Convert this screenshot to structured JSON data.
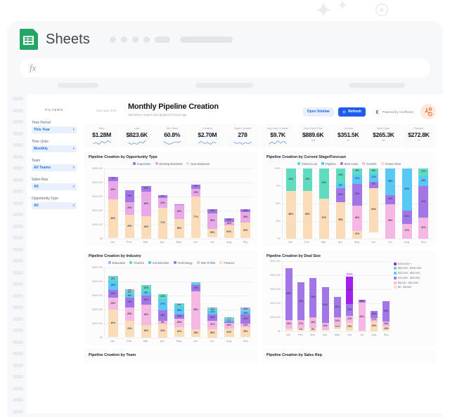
{
  "app": {
    "name": "Sheets",
    "logo_icon": "sheets-icon",
    "formula_placeholder": "fx"
  },
  "dashboard": {
    "logo_placeholder": "Your logo here",
    "title": "Monthly Pipeline Creation",
    "subtitle": "Salesforce import last updated 9 hours ago",
    "buttons": {
      "sidebar": "Open Sidebar",
      "refresh": "Refresh",
      "refresh_icon": "refresh-icon"
    },
    "powered_by": "Powered by Coefficient",
    "powered_icon": "coefficient-icon",
    "brand_icon": "hubspot-icon"
  },
  "filters": {
    "heading": "FILTERS",
    "items": [
      {
        "label": "Time Period",
        "value": "This Year"
      },
      {
        "label": "Time Units",
        "value": "Monthly"
      },
      {
        "label": "Team",
        "value": "All Teams"
      },
      {
        "label": "Sales Rep",
        "value": "All"
      },
      {
        "label": "Opportunity Type",
        "value": "All"
      }
    ]
  },
  "kpis": [
    {
      "label": "Won",
      "value": "$1.28M",
      "count": ""
    },
    {
      "label": "Lost",
      "value": "$823.6K",
      "count": ""
    },
    {
      "label": "Win Rate",
      "value": "60.8%",
      "count": ""
    },
    {
      "label": "Created",
      "value": "$2.70M",
      "count": ""
    },
    {
      "label": "Opps Created",
      "value": "278",
      "count": ""
    },
    {
      "label": "Avg Deal Created",
      "value": "$9.7K",
      "count": ""
    },
    {
      "label": "Total Open Pipe",
      "value": "$889.6K",
      "count": "140"
    },
    {
      "label": "Commit",
      "value": "$351.5K",
      "count": "40"
    },
    {
      "label": "Best Case",
      "value": "$265.3K",
      "count": "25"
    },
    {
      "label": "Pipeline",
      "value": "$272.8K",
      "count": "75"
    }
  ],
  "bottom_cards": [
    {
      "title": "Pipeline Creation by Team"
    },
    {
      "title": "Pipeline Creation by Sales Rep"
    }
  ],
  "chart_data": [
    {
      "type": "bar",
      "stacked": true,
      "title": "Pipeline Creation by Opportunity Type",
      "categories": [
        "Jan",
        "Feb",
        "Mar",
        "Apr",
        "May",
        "Jun",
        "Jul",
        "Aug",
        "Sep"
      ],
      "ylabel": "",
      "xlabel": "",
      "ylim": [
        0,
        500000
      ],
      "yticks": [
        "$0",
        "$100,000",
        "$200,000",
        "$300,000",
        "$400,000",
        "$500,000"
      ],
      "grid": true,
      "legend_position": "top",
      "totals": [
        440000,
        344000,
        375000,
        310000,
        241000,
        385000,
        209000,
        145000,
        206000
      ],
      "series": [
        {
          "name": "New Business",
          "color": "#fbdcb9",
          "values": [
            63,
            49,
            43,
            71,
            58,
            77,
            30,
            64,
            54
          ]
        },
        {
          "name": "Existing Business",
          "color": "#e9a9e9",
          "values": [
            30,
            26,
            46,
            22,
            40,
            15,
            53,
            16,
            36
          ]
        },
        {
          "name": "Expansion",
          "color": "#a376e8",
          "values": [
            7,
            25,
            12,
            8,
            2,
            8,
            14,
            20,
            10
          ]
        }
      ]
    },
    {
      "type": "bar",
      "stacked": true,
      "percent": true,
      "title": "Pipeline Creation by Current Stage/Forecast",
      "categories": [
        "Jan",
        "Feb",
        "Mar",
        "Apr",
        "May",
        "Jun",
        "Jul",
        "Aug",
        "Sep"
      ],
      "ylabel": "",
      "xlabel": "",
      "ylim": [
        0,
        100
      ],
      "yticks": [
        "0%",
        "25%",
        "50%",
        "75%",
        "100%"
      ],
      "grid": true,
      "legend_position": "top",
      "series": [
        {
          "name": "Closed Won",
          "color": "#fbdcb9",
          "values": [
            68,
            68,
            57,
            56,
            11,
            63,
            0,
            0,
            0
          ]
        },
        {
          "name": "Commit",
          "color": "#f5b8e4",
          "values": [
            0,
            0,
            0,
            0,
            36,
            0,
            49,
            21,
            31
          ]
        },
        {
          "name": "Best Case",
          "color": "#a376e8",
          "values": [
            0,
            0,
            0,
            22,
            31,
            9,
            13,
            19,
            47
          ]
        },
        {
          "name": "Pipeline",
          "color": "#5ac8f5",
          "values": [
            0,
            0,
            0,
            8,
            13,
            11,
            38,
            60,
            16
          ]
        },
        {
          "name": "Closed Lost",
          "color": "#5fdcc0",
          "values": [
            32,
            32,
            43,
            23,
            9,
            8,
            0,
            0,
            11
          ]
        }
      ]
    },
    {
      "type": "bar",
      "stacked": true,
      "title": "Pipeline Creation by Industry",
      "categories": [
        "Jan",
        "Feb",
        "Mar",
        "Apr",
        "May",
        "Jun",
        "Jul",
        "Aug",
        "Sep"
      ],
      "ylabel": "",
      "xlabel": "",
      "ylim": [
        0,
        500000
      ],
      "yticks": [
        "$0",
        "$100,000",
        "$200,000",
        "$300,000",
        "$400,000",
        "$500,000"
      ],
      "grid": true,
      "legend_position": "top",
      "totals": [
        440000,
        344000,
        375000,
        310000,
        241000,
        393000,
        213000,
        145000,
        212000
      ],
      "series": [
        {
          "name": "Finance",
          "color": "#fbdcb9",
          "values": [
            44,
            33,
            26,
            32,
            31,
            15,
            28,
            44,
            35
          ]
        },
        {
          "name": "Non Profits",
          "color": "#f5b8e4",
          "values": [
            19,
            28,
            42,
            9,
            25,
            68,
            27,
            26,
            10
          ]
        },
        {
          "name": "Technology",
          "color": "#a376e8",
          "values": [
            13,
            20,
            19,
            26,
            11,
            12,
            23,
            9,
            31
          ]
        },
        {
          "name": "Construction",
          "color": "#5ac8f5",
          "values": [
            14,
            8,
            8,
            27,
            25,
            2,
            12,
            6,
            10
          ]
        },
        {
          "name": "Tourism",
          "color": "#5fdcc0",
          "values": [
            6,
            5,
            13,
            12,
            6,
            1,
            6,
            6,
            3
          ]
        },
        {
          "name": "Education",
          "color": "#9ab8f7",
          "values": [
            3,
            5,
            1,
            1,
            2,
            2,
            5,
            9,
            11
          ]
        }
      ]
    },
    {
      "type": "bar",
      "stacked": true,
      "title": "Pipeline Creation by Deal Size",
      "categories": [
        "Jan",
        "Feb",
        "Mar",
        "Apr",
        "May",
        "Jun",
        "Jul",
        "Aug",
        "Sep"
      ],
      "ylabel": "",
      "xlabel": "",
      "ylim": [
        0,
        500000
      ],
      "yticks": [
        "$0",
        "$100,000",
        "$200,000",
        "$300,000",
        "$400,000",
        "$500,000"
      ],
      "grid": true,
      "legend_position": "right",
      "annotation": "51%",
      "totals": [
        448000,
        346000,
        380000,
        311000,
        245000,
        390000,
        221000,
        143000,
        214000
      ],
      "series": [
        {
          "name": "$0 - $5,000",
          "color": "#fbdcb9",
          "values": [
            3,
            5,
            6,
            3,
            10,
            15,
            1,
            49,
            15
          ]
        },
        {
          "name": "$5,000 - $10,000",
          "color": "#f5b8e4",
          "values": [
            13,
            17,
            20,
            16,
            24,
            12,
            90,
            17,
            16
          ]
        },
        {
          "name": "$10,000 - $25,000",
          "color": "#a376e8",
          "values": [
            83,
            78,
            75,
            81,
            60,
            22,
            9,
            35,
            69
          ]
        },
        {
          "name": "$25,000 - $50,000",
          "color": "#5ac8f5",
          "values": [
            0,
            0,
            0,
            0,
            0,
            0,
            0,
            0,
            0
          ]
        },
        {
          "name": "$50,000 - $100,000",
          "color": "#5fdcc0",
          "values": [
            0,
            0,
            0,
            0,
            0,
            0,
            0,
            0,
            0
          ]
        },
        {
          "name": "$100,000 +",
          "color": "#a21ff0",
          "values": [
            0,
            0,
            0,
            0,
            0,
            51,
            0,
            0,
            0
          ]
        }
      ]
    }
  ]
}
